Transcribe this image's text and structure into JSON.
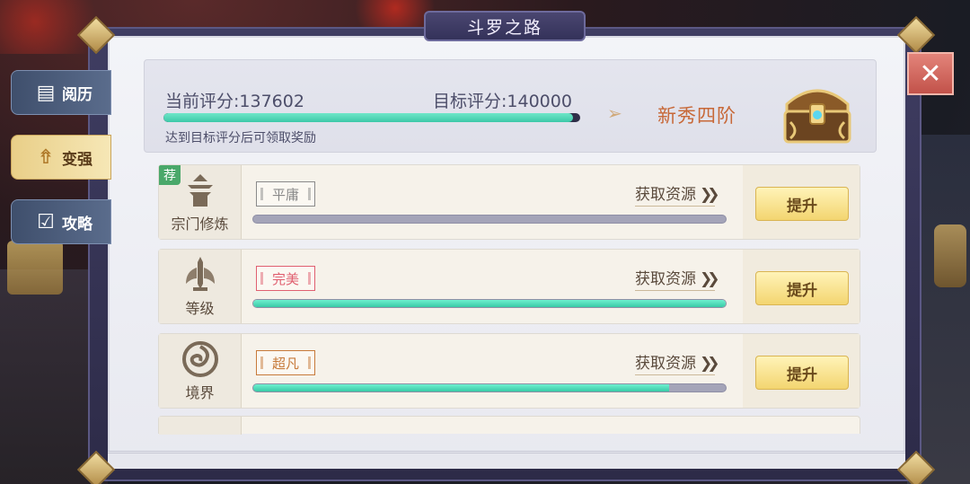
{
  "window": {
    "title": "斗罗之路"
  },
  "colors": {
    "accent": "#3dc8a8",
    "button": "#f3d570",
    "rank": "#c76838",
    "recommend": "#4aa86a"
  },
  "side_tabs": [
    {
      "label": "阅历",
      "icon": "book-icon",
      "active": false
    },
    {
      "label": "变强",
      "icon": "arrows-up-icon",
      "active": true
    },
    {
      "label": "攻略",
      "icon": "checklist-icon",
      "active": false
    }
  ],
  "header": {
    "current_score_label": "当前评分:137602",
    "target_score_label": "目标评分:140000",
    "current_score": 137602,
    "target_score": 140000,
    "hint": "达到目标评分后可领取奖励",
    "rank": "新秀四阶",
    "reward_icon": "treasure-chest-icon"
  },
  "rows": [
    {
      "name": "宗门修炼",
      "icon": "pagoda-icon",
      "recommended": true,
      "recommend_badge": "荐",
      "grade": "平庸",
      "grade_color": "#8a8a8a",
      "progress": 0.0,
      "get_resource": "获取资源",
      "button": "提升"
    },
    {
      "name": "等级",
      "icon": "sword-wings-icon",
      "recommended": false,
      "grade": "完美",
      "grade_color": "#e06070",
      "progress": 1.0,
      "get_resource": "获取资源",
      "button": "提升"
    },
    {
      "name": "境界",
      "icon": "swirl-icon",
      "recommended": false,
      "grade": "超凡",
      "grade_color": "#c77a3a",
      "progress": 0.88,
      "get_resource": "获取资源",
      "button": "提升"
    }
  ]
}
